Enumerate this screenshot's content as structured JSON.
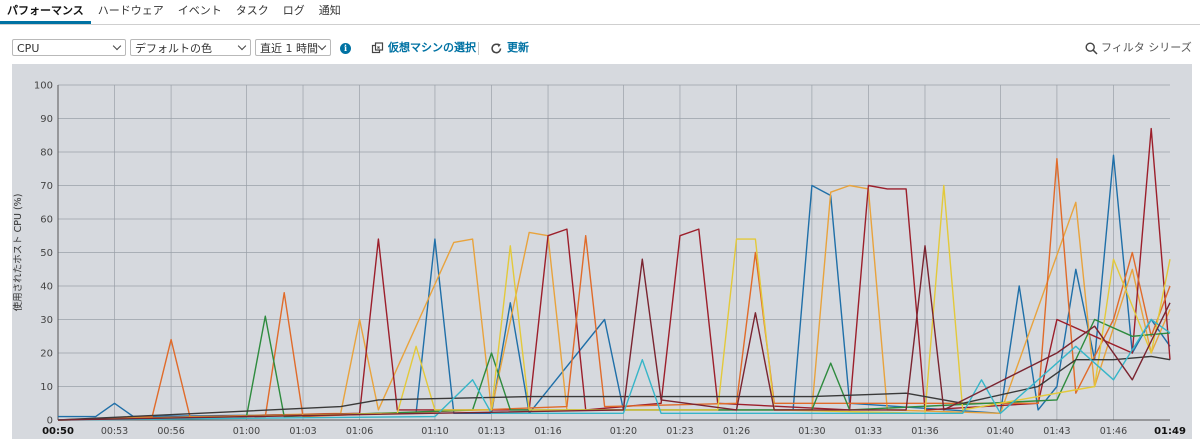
{
  "tabs": [
    {
      "label": "パフォーマンス",
      "active": true
    },
    {
      "label": "ハードウェア",
      "active": false
    },
    {
      "label": "イベント",
      "active": false
    },
    {
      "label": "タスク",
      "active": false
    },
    {
      "label": "ログ",
      "active": false
    },
    {
      "label": "通知",
      "active": false
    }
  ],
  "toolbar": {
    "metric_select": "CPU",
    "color_select": "デフォルトの色",
    "range_select": "直近 1 時間",
    "info_icon": "i",
    "vm_select_label": "仮想マシンの選択",
    "refresh_label": "更新",
    "filter_placeholder": "フィルタ シリーズ"
  },
  "chart_data": {
    "type": "line",
    "title": "",
    "ylabel": "使用されたホスト CPU (%)",
    "xlabel": "",
    "ylim": [
      0,
      100
    ],
    "yticks": [
      0,
      10,
      20,
      30,
      40,
      50,
      60,
      70,
      80,
      90,
      100
    ],
    "xlim": [
      "00:50",
      "01:49"
    ],
    "xticks": [
      "00:50",
      "00:53",
      "00:56",
      "01:00",
      "01:03",
      "01:06",
      "01:10",
      "01:13",
      "01:16",
      "01:20",
      "01:23",
      "01:26",
      "01:30",
      "01:33",
      "01:36",
      "01:40",
      "01:43",
      "01:46",
      "01:49"
    ],
    "xtick_bold": [
      "00:50",
      "01:49"
    ],
    "grid": true,
    "legend": "none",
    "series": [
      {
        "color": "#1f6fa8",
        "points": [
          [
            "00:50",
            1
          ],
          [
            "00:52",
            1
          ],
          [
            "00:53",
            5
          ],
          [
            "00:54",
            1
          ],
          [
            "01:09",
            2
          ],
          [
            "01:10",
            54
          ],
          [
            "01:11",
            2
          ],
          [
            "01:13",
            2
          ],
          [
            "01:14",
            35
          ],
          [
            "01:15",
            2
          ],
          [
            "01:19",
            30
          ],
          [
            "01:20",
            3
          ],
          [
            "01:29",
            3
          ],
          [
            "01:30",
            70
          ],
          [
            "01:31",
            67
          ],
          [
            "01:32",
            5
          ],
          [
            "01:40",
            2
          ],
          [
            "01:41",
            40
          ],
          [
            "01:42",
            3
          ],
          [
            "01:43",
            10
          ],
          [
            "01:44",
            45
          ],
          [
            "01:45",
            18
          ],
          [
            "01:46",
            79
          ],
          [
            "01:47",
            20
          ],
          [
            "01:48",
            30
          ],
          [
            "01:49",
            22
          ]
        ]
      },
      {
        "color": "#e8a33d",
        "points": [
          [
            "00:50",
            0
          ],
          [
            "01:05",
            2
          ],
          [
            "01:06",
            30
          ],
          [
            "01:07",
            3
          ],
          [
            "01:11",
            53
          ],
          [
            "01:12",
            54
          ],
          [
            "01:13",
            3
          ],
          [
            "01:15",
            56
          ],
          [
            "01:16",
            55
          ],
          [
            "01:17",
            3
          ],
          [
            "01:30",
            3
          ],
          [
            "01:31",
            68
          ],
          [
            "01:32",
            70
          ],
          [
            "01:33",
            69
          ],
          [
            "01:34",
            3
          ],
          [
            "01:40",
            2
          ],
          [
            "01:44",
            65
          ],
          [
            "01:45",
            10
          ],
          [
            "01:47",
            45
          ],
          [
            "01:48",
            20
          ],
          [
            "01:49",
            33
          ]
        ]
      },
      {
        "color": "#9c1f2b",
        "points": [
          [
            "00:50",
            0
          ],
          [
            "01:06",
            2
          ],
          [
            "01:07",
            54
          ],
          [
            "01:08",
            3
          ],
          [
            "01:15",
            3
          ],
          [
            "01:16",
            55
          ],
          [
            "01:17",
            57
          ],
          [
            "01:18",
            3
          ],
          [
            "01:22",
            5
          ],
          [
            "01:23",
            55
          ],
          [
            "01:24",
            57
          ],
          [
            "01:25",
            5
          ],
          [
            "01:32",
            3
          ],
          [
            "01:33",
            70
          ],
          [
            "01:34",
            69
          ],
          [
            "01:35",
            69
          ],
          [
            "01:36",
            3
          ],
          [
            "01:42",
            5
          ],
          [
            "01:43",
            30
          ],
          [
            "01:45",
            25
          ],
          [
            "01:47",
            20
          ],
          [
            "01:48",
            87
          ],
          [
            "01:49",
            18
          ]
        ]
      },
      {
        "color": "#e06b2a",
        "points": [
          [
            "00:50",
            0
          ],
          [
            "00:55",
            1
          ],
          [
            "00:56",
            24
          ],
          [
            "00:57",
            1
          ],
          [
            "01:01",
            1
          ],
          [
            "01:02",
            38
          ],
          [
            "01:03",
            1
          ],
          [
            "01:17",
            4
          ],
          [
            "01:18",
            55
          ],
          [
            "01:19",
            4
          ],
          [
            "01:26",
            5
          ],
          [
            "01:27",
            50
          ],
          [
            "01:28",
            5
          ],
          [
            "01:42",
            5
          ],
          [
            "01:43",
            78
          ],
          [
            "01:44",
            8
          ],
          [
            "01:46",
            30
          ],
          [
            "01:47",
            50
          ],
          [
            "01:48",
            25
          ],
          [
            "01:49",
            40
          ]
        ]
      },
      {
        "color": "#2e8b3e",
        "points": [
          [
            "00:50",
            0
          ],
          [
            "01:00",
            1
          ],
          [
            "01:01",
            31
          ],
          [
            "01:02",
            1
          ],
          [
            "01:12",
            3
          ],
          [
            "01:13",
            20
          ],
          [
            "01:14",
            3
          ],
          [
            "01:30",
            3
          ],
          [
            "01:31",
            17
          ],
          [
            "01:32",
            3
          ],
          [
            "01:43",
            6
          ],
          [
            "01:45",
            30
          ],
          [
            "01:47",
            25
          ],
          [
            "01:49",
            26
          ]
        ]
      },
      {
        "color": "#e3c93a",
        "points": [
          [
            "00:50",
            0
          ],
          [
            "01:08",
            2
          ],
          [
            "01:09",
            22
          ],
          [
            "01:10",
            3
          ],
          [
            "01:13",
            3
          ],
          [
            "01:14",
            52
          ],
          [
            "01:15",
            3
          ],
          [
            "01:25",
            3
          ],
          [
            "01:26",
            54
          ],
          [
            "01:27",
            54
          ],
          [
            "01:28",
            3
          ],
          [
            "01:36",
            2
          ],
          [
            "01:37",
            70
          ],
          [
            "01:38",
            3
          ],
          [
            "01:45",
            10
          ],
          [
            "01:46",
            48
          ],
          [
            "01:48",
            20
          ],
          [
            "01:49",
            48
          ]
        ]
      },
      {
        "color": "#3a3a3a",
        "points": [
          [
            "00:50",
            0
          ],
          [
            "01:05",
            4
          ],
          [
            "01:07",
            6
          ],
          [
            "01:15",
            7
          ],
          [
            "01:25",
            7
          ],
          [
            "01:30",
            7
          ],
          [
            "01:35",
            8
          ],
          [
            "01:38",
            5
          ],
          [
            "01:42",
            10
          ],
          [
            "01:44",
            18
          ],
          [
            "01:46",
            18
          ],
          [
            "01:48",
            19
          ],
          [
            "01:49",
            18
          ]
        ]
      },
      {
        "color": "#36b5c8",
        "points": [
          [
            "00:50",
            0
          ],
          [
            "01:10",
            1
          ],
          [
            "01:12",
            12
          ],
          [
            "01:13",
            2
          ],
          [
            "01:20",
            2
          ],
          [
            "01:21",
            18
          ],
          [
            "01:22",
            2
          ],
          [
            "01:38",
            2
          ],
          [
            "01:39",
            12
          ],
          [
            "01:40",
            2
          ],
          [
            "01:44",
            22
          ],
          [
            "01:46",
            12
          ],
          [
            "01:48",
            30
          ],
          [
            "01:49",
            26
          ]
        ]
      },
      {
        "color": "#7a2430",
        "points": [
          [
            "00:50",
            0
          ],
          [
            "01:20",
            3
          ],
          [
            "01:21",
            48
          ],
          [
            "01:22",
            6
          ],
          [
            "01:26",
            3
          ],
          [
            "01:27",
            32
          ],
          [
            "01:28",
            3
          ],
          [
            "01:35",
            3
          ],
          [
            "01:36",
            52
          ],
          [
            "01:37",
            3
          ],
          [
            "01:43",
            20
          ],
          [
            "01:45",
            28
          ],
          [
            "01:47",
            12
          ],
          [
            "01:49",
            35
          ]
        ]
      }
    ]
  }
}
